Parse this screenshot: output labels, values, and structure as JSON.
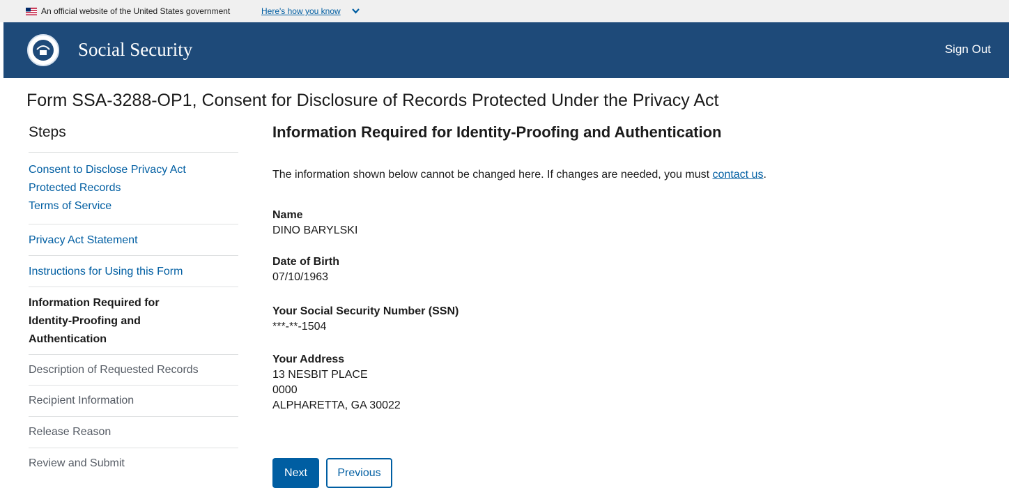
{
  "gov_banner": {
    "official_text": "An official website of the United States government",
    "how_you_know": "Here's how you know"
  },
  "header": {
    "title": "Social Security",
    "sign_out": "Sign Out"
  },
  "page_title": "Form SSA-3288-OP1, Consent for Disclosure of Records Protected Under the Privacy Act",
  "sidebar": {
    "heading": "Steps",
    "steps": [
      {
        "label_line1": "Consent to Disclose Privacy Act",
        "label_line2": "Protected Records",
        "label_line3": "Terms of Service",
        "state": "link"
      },
      {
        "label": "Privacy Act Statement",
        "state": "link"
      },
      {
        "label": "Instructions for Using this Form",
        "state": "link"
      },
      {
        "label_line1": "Information Required for",
        "label_line2": "Identity-Proofing and",
        "label_line3": "Authentication",
        "state": "current"
      },
      {
        "label": "Description of Requested Records",
        "state": "disabled"
      },
      {
        "label": "Recipient Information",
        "state": "disabled"
      },
      {
        "label": "Release Reason",
        "state": "disabled"
      },
      {
        "label": "Review and Submit",
        "state": "disabled"
      }
    ]
  },
  "main": {
    "section_title": "Information Required for Identity-Proofing and Authentication",
    "intro_text": "The information shown below cannot be changed here. If changes are needed, you must ",
    "intro_link": "contact us",
    "intro_end": ".",
    "fields": {
      "name": {
        "label": "Name",
        "value": "DINO BARYLSKI"
      },
      "dob": {
        "label": "Date of Birth",
        "value": "07/10/1963"
      },
      "ssn": {
        "label": "Your Social Security Number (SSN)",
        "value": "***-**-1504"
      },
      "address": {
        "label": "Your Address",
        "line1": "13 NESBIT PLACE",
        "line2": "0000",
        "line3": "ALPHARETTA, GA 30022"
      }
    }
  },
  "buttons": {
    "next": "Next",
    "previous": "Previous"
  },
  "colors": {
    "header_bg": "#1e4a79",
    "link": "#005ea2",
    "banner_bg": "#f0f0f0"
  }
}
